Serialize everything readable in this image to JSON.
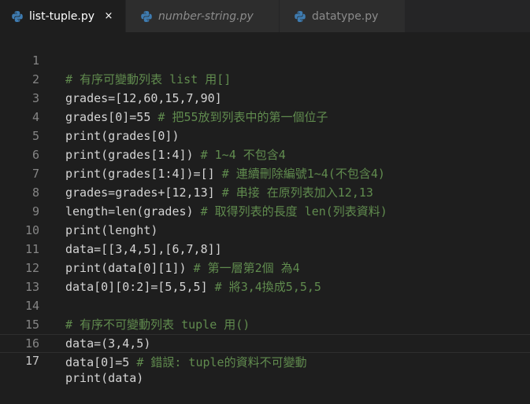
{
  "tabs": [
    {
      "label": "list-tuple.py",
      "icon": "python-icon",
      "active": true,
      "close": "×"
    },
    {
      "label": "number-string.py",
      "icon": "python-icon",
      "active": false
    },
    {
      "label": "datatype.py",
      "icon": "python-icon",
      "active": false
    }
  ],
  "colors": {
    "background": "#1e1e1e",
    "tab_bar": "#252526",
    "inactive_tab": "#2d2d2d",
    "code_text": "#d4d4d4",
    "comment": "#608b4e",
    "line_number": "#858585"
  },
  "editor": {
    "current_line": 17,
    "lines": [
      {
        "n": "1",
        "code": "",
        "comment": "# 有序可變動列表 list 用[]"
      },
      {
        "n": "2",
        "code": "grades=[12,60,15,7,90]",
        "comment": ""
      },
      {
        "n": "3",
        "code": "grades[0]=55 ",
        "comment": "# 把55放到列表中的第一個位子"
      },
      {
        "n": "4",
        "code": "print(grades[0])",
        "comment": ""
      },
      {
        "n": "5",
        "code": "print(grades[1:4]) ",
        "comment": "# 1~4 不包含4"
      },
      {
        "n": "6",
        "code": "print(grades[1:4])=[] ",
        "comment": "# 連續刪除編號1~4(不包含4)"
      },
      {
        "n": "7",
        "code": "grades=grades+[12,13] ",
        "comment": "# 串接 在原列表加入12,13"
      },
      {
        "n": "8",
        "code": "length=len(grades) ",
        "comment": "# 取得列表的長度 len(列表資料)"
      },
      {
        "n": "9",
        "code": "print(lenght)",
        "comment": ""
      },
      {
        "n": "10",
        "code": "data=[[3,4,5],[6,7,8]]",
        "comment": ""
      },
      {
        "n": "11",
        "code": "print(data[0][1]) ",
        "comment": "# 第一層第2個 為4"
      },
      {
        "n": "12",
        "code": "data[0][0:2]=[5,5,5] ",
        "comment": "# 將3,4換成5,5,5"
      },
      {
        "n": "13",
        "code": "",
        "comment": ""
      },
      {
        "n": "14",
        "code": "",
        "comment": "# 有序不可變動列表 tuple 用()"
      },
      {
        "n": "15",
        "code": "data=(3,4,5)",
        "comment": ""
      },
      {
        "n": "16",
        "code": "data[0]=5 ",
        "comment": "# 錯誤: tuple的資料不可變動"
      },
      {
        "n": "17",
        "code": "print(data)",
        "comment": ""
      }
    ]
  }
}
